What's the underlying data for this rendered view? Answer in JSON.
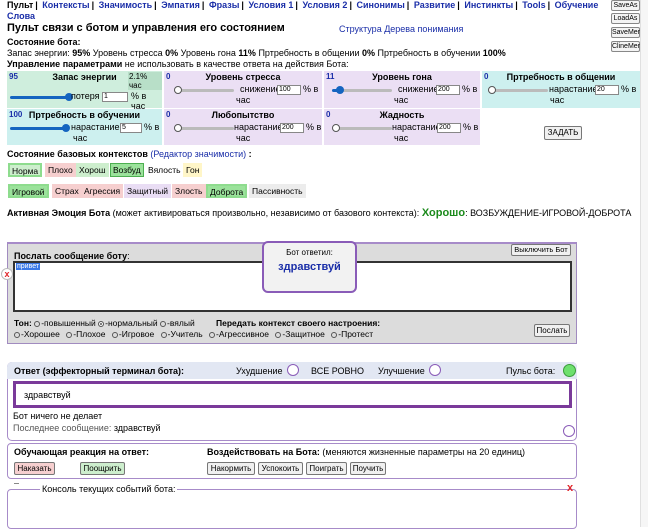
{
  "nav": {
    "items": [
      "Пульт",
      "Контексты",
      "Значимость",
      "Эмпатия",
      "Фразы",
      "Условия 1",
      "Условия 2",
      "Синонимы",
      "Развитие",
      "Инстинкты",
      "Tools",
      "Обучение"
    ],
    "second_line": "Слова"
  },
  "right_buttons": [
    "SaveAs",
    "LoadAs",
    "SaveMem",
    "ClineMem"
  ],
  "header": {
    "title": "Пульт связи с ботом и управления его состоянием",
    "tree_link": "Структура Дерева понимания"
  },
  "state": {
    "heading": "Состояние бота:",
    "energy_label": "Запас энергии:",
    "energy_val": "95%",
    "stress_label": "Уровень стресса",
    "stress_val": "0%",
    "gon_label": "Уровень гона",
    "gon_val": "11%",
    "comm_label": "Пртребность в общении",
    "comm_val": "0%",
    "learn_label": "Пртребность в обучении",
    "learn_val": "100%"
  },
  "params_heading": {
    "bold": "Управление параметрами",
    "rest": " не использовать в качестве ответа на действия Бота:"
  },
  "params": [
    {
      "num": "95",
      "title": "Запас энергии",
      "extra": "2.1% час",
      "action": "потеря",
      "input": "1",
      "unit": "% в час",
      "bg": "#cfeedd",
      "fill": 0.95
    },
    {
      "num": "0",
      "title": "Уровень стресса",
      "action": "снижение",
      "input": "100",
      "unit": "% в",
      "unit2": "час",
      "bg": "#ebdff4",
      "fill": 0
    },
    {
      "num": "11",
      "title": "Уровень гона",
      "action": "снижение",
      "input": "200",
      "unit": "% в",
      "unit2": "час",
      "bg": "#ebdff4",
      "fill": 0.11
    },
    {
      "num": "0",
      "title": "Пртребность в общении",
      "action": "нарастание",
      "input": "20",
      "unit": "% в",
      "unit2": "час",
      "bg": "#cdf0ef",
      "fill": 0
    },
    {
      "num": "100",
      "title": "Пртребность в обучении",
      "action": "нарастание",
      "input": "5",
      "unit": "% в",
      "unit2": "час",
      "bg": "#cdf0ef",
      "fill": 1.0
    },
    {
      "num": "0",
      "title": "Любопытство",
      "action": "нарастание",
      "input": "200",
      "unit": "% в",
      "unit2": "час",
      "bg": "#ebdff4",
      "fill": 0
    },
    {
      "num": "0",
      "title": "Жадность",
      "action": "нарастание",
      "input": "200",
      "unit": "% в",
      "unit2": "час",
      "bg": "#ebdff4",
      "fill": 0
    }
  ],
  "set_button": "ЗАДАТЬ",
  "contexts": {
    "heading": "Состояние базовых контекстов",
    "editor_link": "(Редактор значимости)",
    "colon": ":",
    "row1": [
      {
        "label": "Норма",
        "bg": "#cdeecd",
        "active": true
      },
      {
        "label": "Плохо",
        "bg": "#f6cfcf",
        "active": false
      },
      {
        "label": "Хорош",
        "bg": "#cdeecd",
        "active": false
      },
      {
        "label": "Возбуд",
        "bg": "#9be29b",
        "active": true
      },
      {
        "label": "Вялость",
        "bg": "#ffffff",
        "active": false
      },
      {
        "label": "Гон",
        "bg": "#fff6c8",
        "active": false
      }
    ],
    "row2": [
      {
        "label": "Игровой",
        "bg": "#9be29b",
        "active": true
      },
      {
        "label": "Страх",
        "bg": "#f6cfcf",
        "active": false
      },
      {
        "label": "Агрессия",
        "bg": "#f6cfcf",
        "active": false
      },
      {
        "label": "Защитный",
        "bg": "#e9ddf4",
        "active": false
      },
      {
        "label": "Злость",
        "bg": "#f6cfcf",
        "active": false
      },
      {
        "label": "Доброта",
        "bg": "#9be29b",
        "active": true
      },
      {
        "label": "Пассивность",
        "bg": "#ececec",
        "active": false
      }
    ]
  },
  "emotion": {
    "label": "Активная Эмоция Бота",
    "note": " (может активироваться произвольно, независимо от базового контекста):",
    "value": "Хорошо",
    "tail": ": ВОЗБУЖДЕНИЕ-ИГРОВОЙ-ДОБРОТА"
  },
  "send": {
    "label": "Послать сообщение боту",
    "colon": ":",
    "text": "привет",
    "off_button": "Выключить Бот",
    "post_button": "Послать"
  },
  "bot_reply": {
    "label": "Бот ответил:",
    "text": "здравствуй"
  },
  "tone": {
    "label": "Тон:",
    "options": [
      "-повышенный",
      "-нормальный",
      "-вялый"
    ],
    "selected": 1
  },
  "mood": {
    "label": "Передать контекст своего настроения:",
    "options": [
      "-Хорошее",
      "-Плохое",
      "-Игровое",
      "-Учитель",
      "-Агрессивное",
      "-Защитное",
      "-Протест"
    ]
  },
  "answer": {
    "label": "Ответ (эффекторный терминал бота):",
    "worse": "Ухудшение",
    "all_ok": "ВСЕ РОВНО",
    "better": "Улучшение",
    "pulse": "Пульс бота:",
    "text": "здравствуй",
    "status": "Бот ничего не делает",
    "last_label": "Последнее сообщение:",
    "last_val": "здравствуй"
  },
  "training": {
    "label": "Обучающая реакция на ответ:",
    "punish": "Наказать",
    "reward": "Поощрить",
    "affect_label": "Воздействовать на Бота:",
    "affect_note": " (меняются жизненные параметры на 20 единиц)",
    "buttons": [
      "Накормить",
      "Успокоить",
      "Поиграть",
      "Поучить"
    ]
  },
  "console": {
    "label": "Консоль текущих событий бота:"
  },
  "close_glyph": "x"
}
